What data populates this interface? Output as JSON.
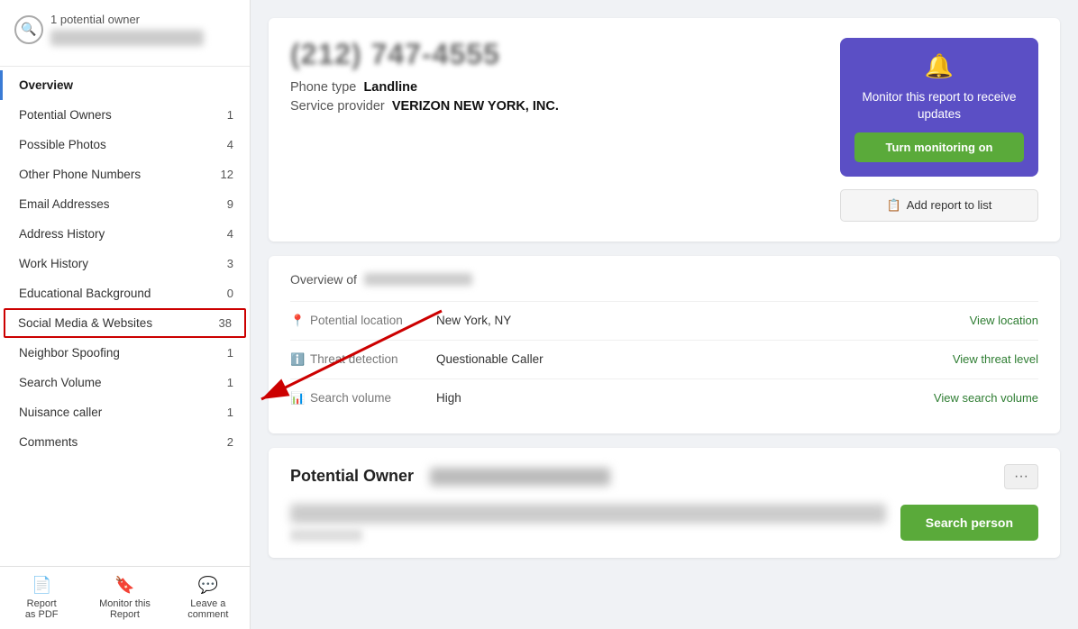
{
  "sidebar": {
    "potential_owner_count": "1 potential owner",
    "nav_items": [
      {
        "label": "Overview",
        "badge": "",
        "active": true,
        "highlighted": false
      },
      {
        "label": "Potential Owners",
        "badge": "1",
        "active": false,
        "highlighted": false
      },
      {
        "label": "Possible Photos",
        "badge": "4",
        "active": false,
        "highlighted": false
      },
      {
        "label": "Other Phone Numbers",
        "badge": "12",
        "active": false,
        "highlighted": false
      },
      {
        "label": "Email Addresses",
        "badge": "9",
        "active": false,
        "highlighted": false
      },
      {
        "label": "Address History",
        "badge": "4",
        "active": false,
        "highlighted": false
      },
      {
        "label": "Work History",
        "badge": "3",
        "active": false,
        "highlighted": false
      },
      {
        "label": "Educational Background",
        "badge": "0",
        "active": false,
        "highlighted": false
      },
      {
        "label": "Social Media & Websites",
        "badge": "38",
        "active": false,
        "highlighted": true
      },
      {
        "label": "Neighbor Spoofing",
        "badge": "1",
        "active": false,
        "highlighted": false
      },
      {
        "label": "Search Volume",
        "badge": "1",
        "active": false,
        "highlighted": false
      },
      {
        "label": "Nuisance caller",
        "badge": "1",
        "active": false,
        "highlighted": false
      },
      {
        "label": "Comments",
        "badge": "2",
        "active": false,
        "highlighted": false
      }
    ],
    "bottom_buttons": [
      {
        "label": "Report\nas PDF",
        "icon": "📄"
      },
      {
        "label": "Monitor this\nReport",
        "icon": "🔖"
      },
      {
        "label": "Leave a\ncomment",
        "icon": "💬"
      }
    ]
  },
  "header": {
    "phone_number": "(212) 747-4555",
    "phone_type_label": "Phone type",
    "phone_type_value": "Landline",
    "provider_label": "Service provider",
    "provider_value": "VERIZON NEW YORK, INC.",
    "monitor_text": "Monitor this report to receive updates",
    "monitor_btn": "Turn monitoring on",
    "add_list_btn": "Add report to list"
  },
  "overview": {
    "title": "Overview of",
    "rows": [
      {
        "icon": "📍",
        "label": "Potential location",
        "value": "New York, NY",
        "link": "View location"
      },
      {
        "icon": "ℹ",
        "label": "Threat detection",
        "value": "Questionable Caller",
        "link": "View threat level"
      },
      {
        "icon": "📊",
        "label": "Search volume",
        "value": "High",
        "link": "View search volume"
      }
    ]
  },
  "potential_owner": {
    "section_title": "Potential Owner",
    "search_btn": "Search person"
  }
}
